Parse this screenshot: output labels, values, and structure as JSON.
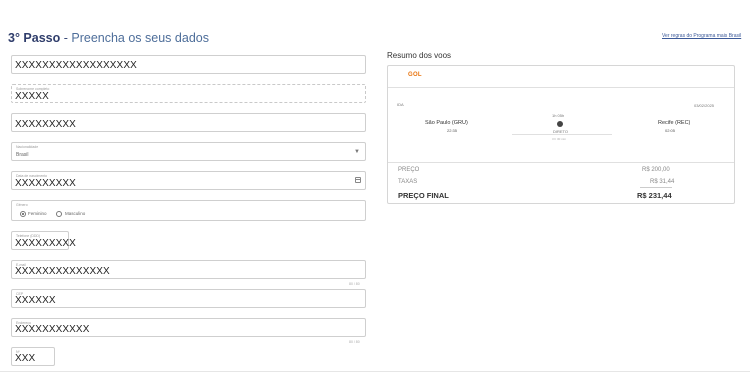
{
  "header": {
    "step": "3° Passo",
    "separator": " - ",
    "title": "Preencha os seus dados",
    "program_link": "Ver regras do Programa mais Brasil"
  },
  "form": {
    "name_value": "XXXXXXXXXXXXXXXXXX",
    "surname_label": "Sobrenome completo",
    "surname_value": "XXXXX",
    "cpf_value": "XXXXXXXXX",
    "nationality_label": "Nacionalidade",
    "nationality_value": "Brasil",
    "birth_label": "Data de nascimento",
    "birth_value": "XXXXXXXXX",
    "gender_label": "Gênero",
    "gender_female": "Feminino",
    "gender_male": "Masculino",
    "phone_label": "Telefone (DDD)",
    "phone_value": "XXXXXXXXX",
    "email_label": "E-mail",
    "email_value": "XXXXXXXXXXXXXX",
    "email_counter": "80 / 80",
    "cep_label": "CEP",
    "cep_value": "XXXXXX",
    "address_label": "Endereço",
    "address_value": "XXXXXXXXXXX",
    "address_counter": "80 / 80",
    "number_label": "Nº",
    "number_value": "XXX"
  },
  "summary": {
    "title": "Resumo dos voos",
    "airline": "GOL",
    "leg_label": "IDA",
    "date": "03/02/2025",
    "duration_top": "1h 05h",
    "origin_city": "São Paulo (GRU)",
    "origin_time": "22:35",
    "destination_city": "Recife (REC)",
    "destination_time": "02:05",
    "stop_type": "DIRETO",
    "duration_bottom": "3 h 30 min",
    "price_label": "PREÇO",
    "price_value": "R$ 200,00",
    "taxes_label": "TAXAS",
    "taxes_value": "R$ 31,44",
    "final_label": "PREÇO FINAL",
    "final_value": "R$ 231,44"
  }
}
